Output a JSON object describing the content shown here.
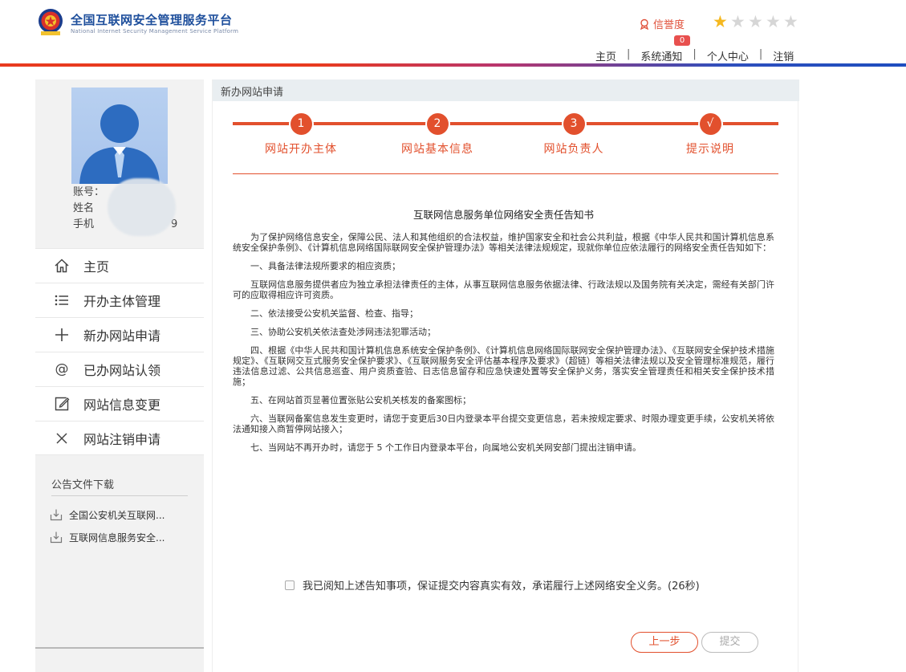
{
  "header": {
    "title": "全国互联网安全管理服务平台",
    "subtitle": "National Internet Security Management Service Platform",
    "credit_label": "信誉度",
    "stars_total": 5,
    "stars_filled": 1,
    "notification_badge": "0",
    "nav": [
      "主页",
      "系统通知",
      "个人中心",
      "注销"
    ],
    "colors": {
      "brand_blue": "#1e4f9c",
      "accent_red": "#e2502d",
      "star": "#f5b820"
    }
  },
  "user": {
    "account_label": "账号：",
    "name_label": "姓名",
    "phone_label": "手机",
    "phone_tail": "9"
  },
  "sidebar": {
    "menu": [
      {
        "label": "主页",
        "icon": "home-icon"
      },
      {
        "label": "开办主体管理",
        "icon": "list-icon"
      },
      {
        "label": "新办网站申请",
        "icon": "plus-icon"
      },
      {
        "label": "已办网站认领",
        "icon": "at-icon"
      },
      {
        "label": "网站信息变更",
        "icon": "edit-icon"
      },
      {
        "label": "网站注销申请",
        "icon": "close-icon"
      }
    ],
    "downloads_title": "公告文件下载",
    "downloads": [
      "全国公安机关互联网...",
      "互联网信息服务安全..."
    ]
  },
  "main": {
    "panel_title": "新办网站申请",
    "steps": [
      {
        "mark": "1",
        "label": "网站开办主体"
      },
      {
        "mark": "2",
        "label": "网站基本信息"
      },
      {
        "mark": "3",
        "label": "网站负责人"
      },
      {
        "mark": "√",
        "label": "提示说明"
      }
    ],
    "notice_title": "互联网信息服务单位网络安全责任告知书",
    "notice_paragraphs": [
      "为了保护网络信息安全，保障公民、法人和其他组织的合法权益，维护国家安全和社会公共利益，根据《中华人民共和国计算机信息系统安全保护条例》、《计算机信息网络国际联网安全保护管理办法》等相关法律法规规定，现就你单位应依法履行的网络安全责任告知如下：",
      "一、具备法律法规所要求的相应资质；",
      "互联网信息服务提供者应为独立承担法律责任的主体，从事互联网信息服务依据法律、行政法规以及国务院有关决定，需经有关部门许可的应取得相应许可资质。",
      "二、依法接受公安机关监督、检查、指导；",
      "三、协助公安机关依法查处涉网违法犯罪活动；",
      "四、根据《中华人民共和国计算机信息系统安全保护条例》、《计算机信息网络国际联网安全保护管理办法》、《互联网安全保护技术措施规定》、《互联网交互式服务安全保护要求》、《互联网服务安全评估基本程序及要求》（超链）等相关法律法规以及安全管理标准规范，履行违法信息过滤、公共信息巡查、用户资质查验、日志信息留存和应急快速处置等安全保护义务，落实安全管理责任和相关安全保护技术措施；",
      "五、在网站首页显著位置张贴公安机关核发的备案图标；",
      "六、当联网备案信息发生变更时，请您于变更后30日内登录本平台提交变更信息，若未按规定要求、时限办理变更手续，公安机关将依法通知接入商暂停网站接入；",
      "七、当网站不再开办时，请您于 5 个工作日内登录本平台，向属地公安机关网安部门提出注销申请。"
    ],
    "agree_text": "我已阅知上述告知事项，保证提交内容真实有效，承诺履行上述网络安全义务。(26秒)",
    "prev_button": "上一步",
    "submit_button": "提交"
  }
}
